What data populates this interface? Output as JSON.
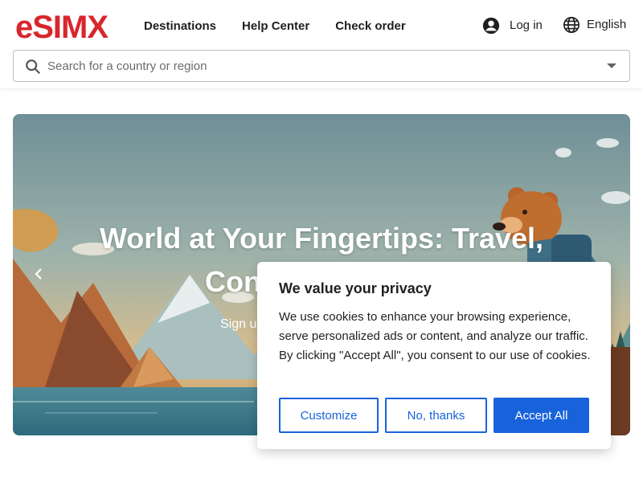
{
  "header": {
    "logo": "eSIMX",
    "nav": [
      "Destinations",
      "Help Center",
      "Check order"
    ],
    "login_label": "Log in",
    "language_label": "English",
    "search": {
      "placeholder": "Search for a country or region"
    }
  },
  "hero": {
    "title_line1": "World at Your Fingertips: Travel,",
    "title_line2": "Con",
    "subtitle": "Sign up"
  },
  "cookie": {
    "title": "We value your privacy",
    "body": "We use cookies to enhance your browsing experience, serve personalized ads or content, and analyze our traffic. By clicking \"Accept All\", you consent to our use of cookies.",
    "customize": "Customize",
    "reject": "No, thanks",
    "accept": "Accept All"
  },
  "colors": {
    "brand": "#d8262c",
    "primary": "#1863dc"
  }
}
